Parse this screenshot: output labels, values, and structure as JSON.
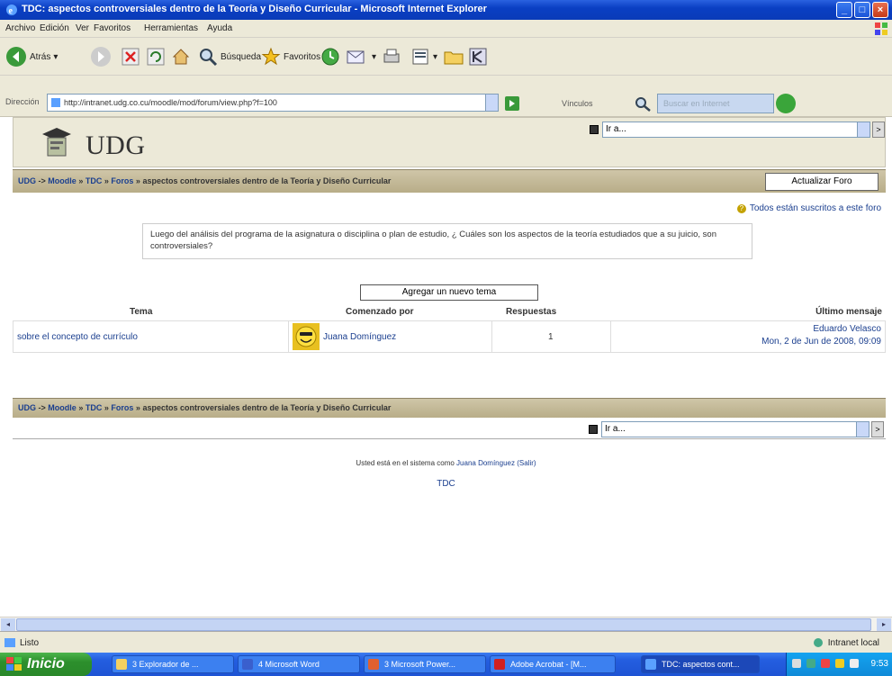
{
  "window": {
    "title": "TDC: aspectos controversiales dentro de la Teoría y Diseño Curricular - Microsoft Internet Explorer"
  },
  "menu": [
    "Archivo",
    "Edición",
    "Ver",
    "Favoritos",
    "Herramientas",
    "Ayuda"
  ],
  "toolbar": {
    "back": "Atrás",
    "search": "Búsqueda",
    "favorites": "Favoritos"
  },
  "address": {
    "label": "Dirección",
    "url": "http://intranet.udg.co.cu/moodle/mod/forum/view.php?f=100",
    "links_label": "Vínculos",
    "search_placeholder": "Buscar en Internet"
  },
  "site": {
    "logo_text": "UDG",
    "jump_value": "Ir a..."
  },
  "breadcrumb": {
    "items": [
      "UDG",
      "Moodle",
      "TDC",
      "Foros"
    ],
    "current": "aspectos controversiales dentro de la Teoría y Diseño Curricular",
    "prefix_sep": "->",
    "sep": "»"
  },
  "forum": {
    "update_button": "Actualizar Foro",
    "subscription_note": "Todos están suscritos a este foro",
    "intro": "Luego del análisis del programa de la asignatura o disciplina o plan de estudio, ¿ Cuáles son los aspectos de la teoría estudiados que a su juicio, son controversiales?",
    "add_topic_button": "Agregar un nuevo tema",
    "columns": {
      "topic": "Tema",
      "started_by": "Comenzado por",
      "replies": "Respuestas",
      "last_post": "Último mensaje"
    },
    "rows": [
      {
        "topic": "sobre el concepto de currículo",
        "author": "Juana Domínguez",
        "replies": "1",
        "last_author": "Eduardo Velasco",
        "last_date": "Mon, 2 de Jun de 2008, 09:09"
      }
    ]
  },
  "footer": {
    "login_prefix": "Usted está en el sistema como",
    "login_user": "Juana Domínguez",
    "logout": "(Salir)",
    "course_link": "TDC"
  },
  "status": {
    "done": "Listo",
    "zone": "Intranet local"
  },
  "taskbar": {
    "start": "Inicio",
    "tasks": [
      "3 Explorador de ...",
      "4 Microsoft Word",
      "3 Microsoft Power...",
      "Adobe Acrobat - [M...",
      "TDC: aspectos cont..."
    ],
    "clock": "9:53"
  },
  "colors": {
    "titlebar": "#0a3fc3",
    "link": "#1b3f8f",
    "navbar": "#cfc6a8",
    "start": "#2c8f2c"
  }
}
